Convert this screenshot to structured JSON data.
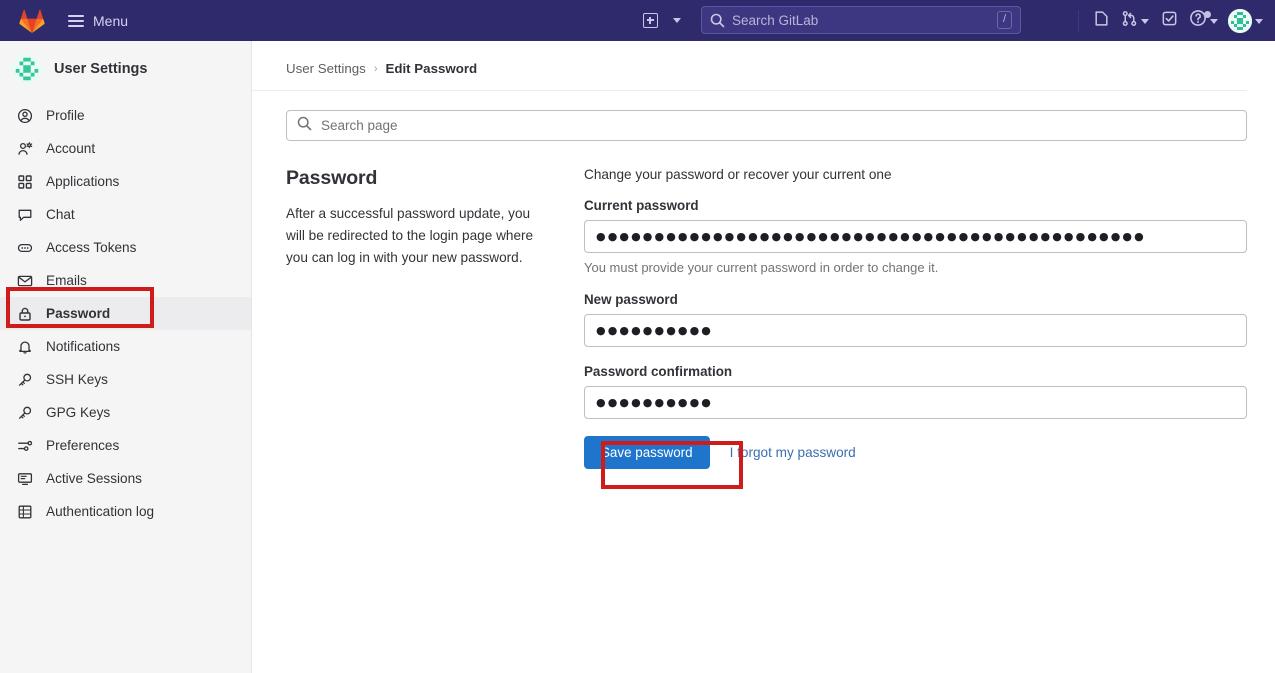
{
  "navbar": {
    "logo_icon": "gitlab-tanuki-logo",
    "menu_label": "Menu",
    "menu_icon": "hamburger-icon",
    "new_icon": "plus-square-icon",
    "new_chevron_icon": "chevron-down-icon",
    "search": {
      "placeholder": "Search GitLab",
      "icon": "search-icon",
      "shortcut": "/"
    },
    "right_icons": [
      {
        "name": "issues-icon",
        "label": "Issues"
      },
      {
        "name": "merge-requests-icon",
        "label": "Merge requests"
      },
      {
        "name": "todos-icon",
        "label": "To-Do List"
      },
      {
        "name": "help-icon",
        "label": "Help"
      },
      {
        "name": "user-avatar",
        "label": "User menu"
      }
    ]
  },
  "sidebar": {
    "title": "User Settings",
    "avatar_icon": "user-identicon-avatar",
    "items": [
      {
        "label": "Profile",
        "icon": "user-circle-icon",
        "active": false
      },
      {
        "label": "Account",
        "icon": "account-settings-icon",
        "active": false
      },
      {
        "label": "Applications",
        "icon": "applications-grid-icon",
        "active": false
      },
      {
        "label": "Chat",
        "icon": "chat-bubble-icon",
        "active": false
      },
      {
        "label": "Access Tokens",
        "icon": "token-icon",
        "active": false
      },
      {
        "label": "Emails",
        "icon": "envelope-icon",
        "active": false
      },
      {
        "label": "Password",
        "icon": "lock-icon",
        "active": true
      },
      {
        "label": "Notifications",
        "icon": "bell-icon",
        "active": false
      },
      {
        "label": "SSH Keys",
        "icon": "key-icon",
        "active": false
      },
      {
        "label": "GPG Keys",
        "icon": "key-icon",
        "active": false
      },
      {
        "label": "Preferences",
        "icon": "preferences-sliders-icon",
        "active": false
      },
      {
        "label": "Active Sessions",
        "icon": "monitor-icon",
        "active": false
      },
      {
        "label": "Authentication log",
        "icon": "log-table-icon",
        "active": false
      }
    ]
  },
  "breadcrumb": {
    "root": "User Settings",
    "separator": "›",
    "current": "Edit Password"
  },
  "page_search": {
    "placeholder": "Search page",
    "icon": "search-icon"
  },
  "settings": {
    "heading": "Password",
    "description": "After a successful password update, you will be redirected to the login page where you can log in with your new password.",
    "legend": "Change your password or recover your current one",
    "fields": [
      {
        "label": "Current password",
        "value": "●●●●●●●●●●●●●●●●●●●●●●●●●●●●●●●●●●●●●●●●●●●●●●●",
        "help": "You must provide your current password in order to change it."
      },
      {
        "label": "New password",
        "value": "●●●●●●●●●●",
        "help": ""
      },
      {
        "label": "Password confirmation",
        "value": "●●●●●●●●●●",
        "help": ""
      }
    ],
    "save_button": "Save password",
    "forgot_link": "I forgot my password"
  },
  "colors": {
    "navbar_bg": "#2f2a6b",
    "sidebar_bg": "#f5f5f5",
    "active_item_bg": "#ececef",
    "primary_button": "#1f75cb",
    "link": "#3a6fb0",
    "highlight_box": "#d01b1b"
  },
  "highlights": [
    {
      "target": "sidebar-item-password",
      "color": "#d01b1b"
    },
    {
      "target": "save-password-button",
      "color": "#d01b1b"
    }
  ]
}
